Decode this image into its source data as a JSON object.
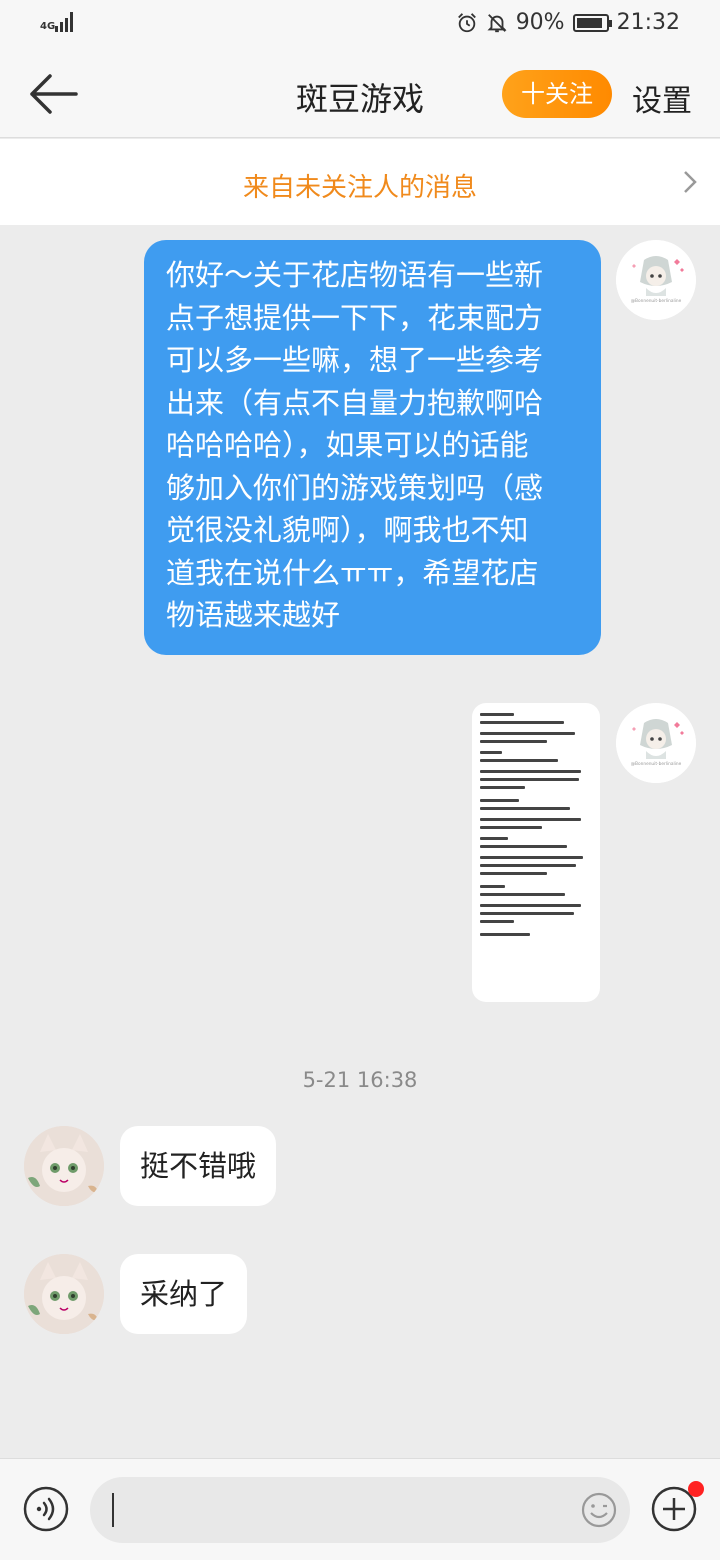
{
  "status_bar": {
    "network": "4G",
    "battery": "90%",
    "battery_level": 0.9,
    "time": "21:32",
    "icons": [
      "signal-icon",
      "alarm-icon",
      "mute-icon",
      "battery-icon"
    ]
  },
  "header": {
    "title": "斑豆游戏",
    "follow_label": "十关注",
    "settings_label": "设置",
    "back_icon": "back-arrow-icon"
  },
  "notice": {
    "text": "来自未关注人的消息"
  },
  "messages": [
    {
      "side": "right",
      "type": "text",
      "lines": [
        "你好～关于花店物语有一些新",
        "点子想提供一下下，花束配方",
        "可以多一些嘛，想了一些参考",
        "出来（有点不自量力抱歉啊哈",
        "哈哈哈哈），如果可以的话能",
        "够加入你们的游戏策划吗（感",
        "觉很没礼貌啊），啊我也不知",
        "道我在说什么ㅠㅠ，希望花店",
        "物语越来越好"
      ],
      "avatar_watermark": "@Bonnenuit-berlinaline"
    },
    {
      "side": "right",
      "type": "image",
      "avatar_watermark": "@Bonnenuit-berlinaline"
    },
    {
      "type": "timestamp",
      "text": "5-21 16:38"
    },
    {
      "side": "left",
      "type": "text",
      "text": "挺不错哦"
    },
    {
      "side": "left",
      "type": "text",
      "text": "采纳了"
    }
  ],
  "input_bar": {
    "voice_icon": "voice-icon",
    "emoji_icon": "emoji-icon",
    "plus_icon": "plus-icon"
  }
}
